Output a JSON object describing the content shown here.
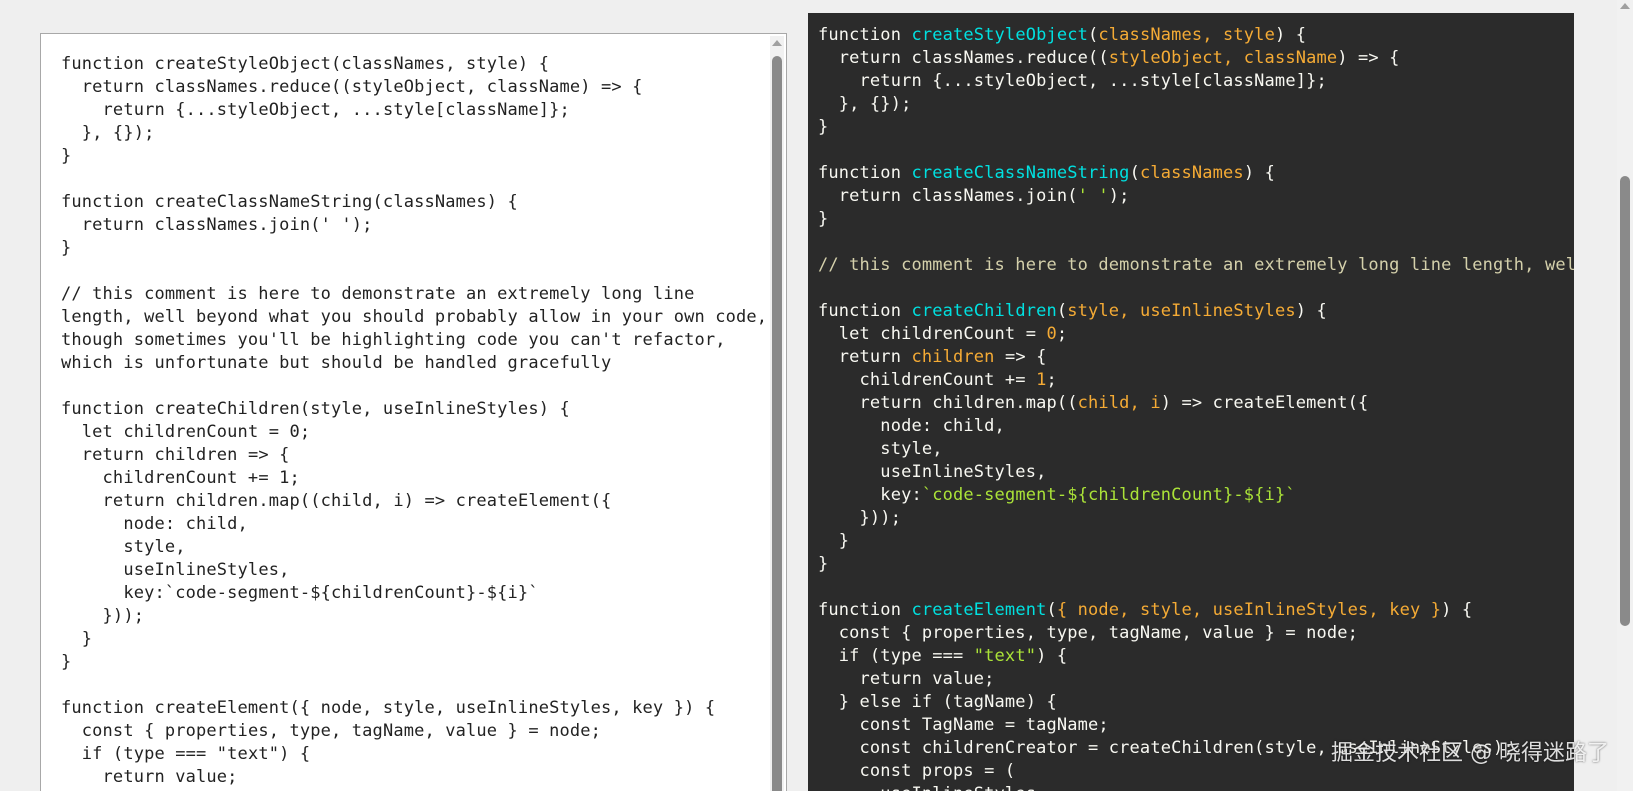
{
  "left_editor": {
    "lines": [
      "function createStyleObject(classNames, style) {",
      "  return classNames.reduce((styleObject, className) => {",
      "    return {...styleObject, ...style[className]};",
      "  }, {});",
      "}",
      "",
      "function createClassNameString(classNames) {",
      "  return classNames.join(' ');",
      "}",
      "",
      "// this comment is here to demonstrate an extremely long line",
      "length, well beyond what you should probably allow in your own code,",
      "though sometimes you'll be highlighting code you can't refactor,",
      "which is unfortunate but should be handled gracefully",
      "",
      "function createChildren(style, useInlineStyles) {",
      "  let childrenCount = 0;",
      "  return children => {",
      "    childrenCount += 1;",
      "    return children.map((child, i) => createElement({",
      "      node: child,",
      "      style,",
      "      useInlineStyles,",
      "      key:`code-segment-${childrenCount}-${i}`",
      "    }));",
      "  }",
      "}",
      "",
      "function createElement({ node, style, useInlineStyles, key }) {",
      "  const { properties, type, tagName, value } = node;",
      "  if (type === \"text\") {",
      "    return value;"
    ]
  },
  "right_viewer": {
    "lines": [
      [
        [
          "kw",
          "function "
        ],
        [
          "fn",
          "createStyleObject"
        ],
        [
          "p",
          "("
        ],
        [
          "param",
          "classNames, style"
        ],
        [
          "p",
          ") {"
        ]
      ],
      [
        [
          "p",
          "  return classNames.reduce(("
        ],
        [
          "param",
          "styleObject, className"
        ],
        [
          "p",
          ") => {"
        ]
      ],
      [
        [
          "p",
          "    return {...styleObject, ...style[className]};"
        ]
      ],
      [
        [
          "p",
          "  }, {});"
        ]
      ],
      [
        [
          "p",
          "}"
        ]
      ],
      [
        [
          "p",
          ""
        ]
      ],
      [
        [
          "kw",
          "function "
        ],
        [
          "fn",
          "createClassNameString"
        ],
        [
          "p",
          "("
        ],
        [
          "param",
          "classNames"
        ],
        [
          "p",
          ") {"
        ]
      ],
      [
        [
          "p",
          "  return classNames.join("
        ],
        [
          "str",
          "' '"
        ],
        [
          "p",
          ");"
        ]
      ],
      [
        [
          "p",
          "}"
        ]
      ],
      [
        [
          "p",
          ""
        ]
      ],
      [
        [
          "comment",
          "// this comment is here to demonstrate an extremely long line length, well b"
        ]
      ],
      [
        [
          "p",
          ""
        ]
      ],
      [
        [
          "kw",
          "function "
        ],
        [
          "fn",
          "createChildren"
        ],
        [
          "p",
          "("
        ],
        [
          "param",
          "style, useInlineStyles"
        ],
        [
          "p",
          ") {"
        ]
      ],
      [
        [
          "p",
          "  let childrenCount = "
        ],
        [
          "num",
          "0"
        ],
        [
          "p",
          ";"
        ]
      ],
      [
        [
          "p",
          "  return "
        ],
        [
          "param",
          "children"
        ],
        [
          "p",
          " => {"
        ]
      ],
      [
        [
          "p",
          "    childrenCount += "
        ],
        [
          "num",
          "1"
        ],
        [
          "p",
          ";"
        ]
      ],
      [
        [
          "p",
          "    return children.map(("
        ],
        [
          "param",
          "child, i"
        ],
        [
          "p",
          ") => createElement({"
        ]
      ],
      [
        [
          "p",
          "      node: child,"
        ]
      ],
      [
        [
          "p",
          "      style,"
        ]
      ],
      [
        [
          "p",
          "      useInlineStyles,"
        ]
      ],
      [
        [
          "p",
          "      key:"
        ],
        [
          "str",
          "`code-segment-${childrenCount}-${i}`"
        ]
      ],
      [
        [
          "p",
          "    }));"
        ]
      ],
      [
        [
          "p",
          "  }"
        ]
      ],
      [
        [
          "p",
          "}"
        ]
      ],
      [
        [
          "p",
          ""
        ]
      ],
      [
        [
          "kw",
          "function "
        ],
        [
          "fn",
          "createElement"
        ],
        [
          "p",
          "("
        ],
        [
          "param",
          "{ node, style, useInlineStyles, key }"
        ],
        [
          "p",
          ") {"
        ]
      ],
      [
        [
          "p",
          "  const { properties, type, tagName, value } = node;"
        ]
      ],
      [
        [
          "p",
          "  if (type === "
        ],
        [
          "str",
          "\"text\""
        ],
        [
          "p",
          ") {"
        ]
      ],
      [
        [
          "p",
          "    return value;"
        ]
      ],
      [
        [
          "p",
          "  } else if (tagName) {"
        ]
      ],
      [
        [
          "p",
          "    const TagName = tagName;"
        ]
      ],
      [
        [
          "p",
          "    const childrenCreator = createChildren(style, useInlineStyles);"
        ]
      ],
      [
        [
          "p",
          "    const props = ("
        ]
      ],
      [
        [
          "p",
          "      useInlineStyles"
        ]
      ]
    ]
  },
  "watermark": "掘金技术社区 @ 晓得迷路了",
  "colors": {
    "page_bg": "#efefef",
    "left_bg": "#ffffff",
    "right_bg": "#2b2b2b",
    "fn": "#00e0e0",
    "param": "#f5ab35",
    "string": "#abe338",
    "comment": "#d4d0ab"
  }
}
